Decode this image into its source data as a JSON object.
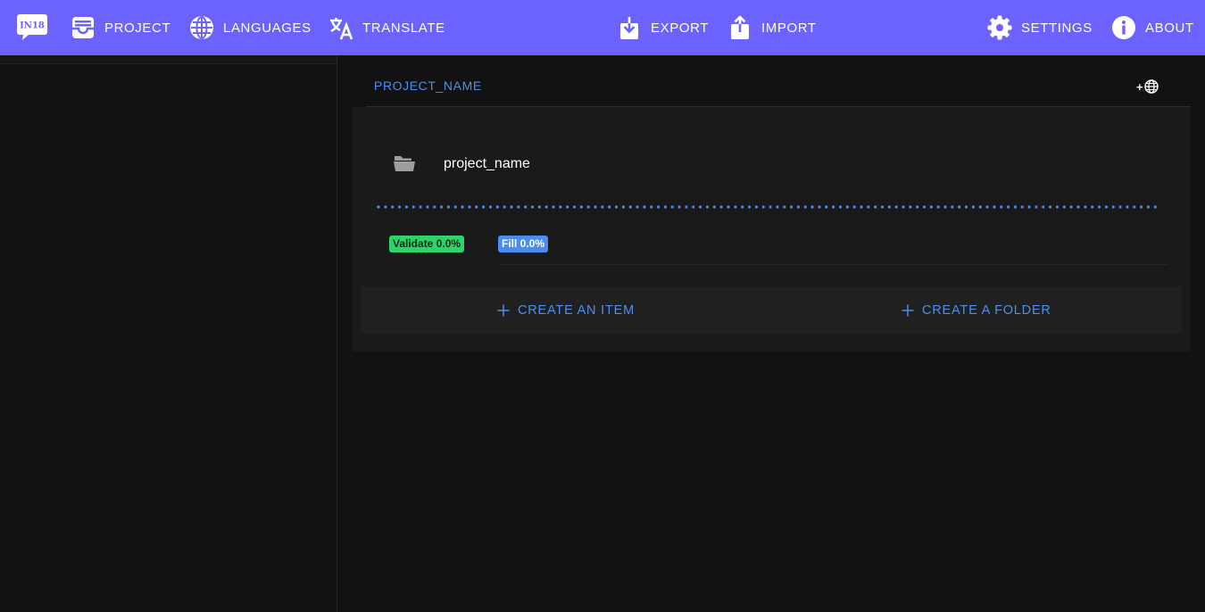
{
  "nav": {
    "logo_text": "IN18",
    "items": [
      {
        "label": "PROJECT",
        "icon": "project-inbox-icon"
      },
      {
        "label": "LANGUAGES",
        "icon": "globe-icon"
      },
      {
        "label": "TRANSLATE",
        "icon": "translate-icon"
      },
      {
        "label": "EXPORT",
        "icon": "export-download-icon"
      },
      {
        "label": "IMPORT",
        "icon": "import-upload-icon"
      },
      {
        "label": "SETTINGS",
        "icon": "gear-icon"
      },
      {
        "label": "ABOUT",
        "icon": "info-icon"
      }
    ]
  },
  "breadcrumb": {
    "project": "PROJECT_NAME",
    "add_language_symbol": "+",
    "add_language_icon": "globe-icon"
  },
  "folder": {
    "name": "project_name",
    "icon": "folder-open-icon"
  },
  "stats": {
    "validate": "Validate 0.0%",
    "fill": "Fill 0.0%"
  },
  "actions": {
    "create_item": "CREATE AN ITEM",
    "create_folder": "CREATE A FOLDER"
  },
  "colors": {
    "accent": "#6c63ff",
    "link": "#4d8ef0",
    "validate": "#2ed36a",
    "fill": "#4a8cf0",
    "background": "#121212"
  }
}
